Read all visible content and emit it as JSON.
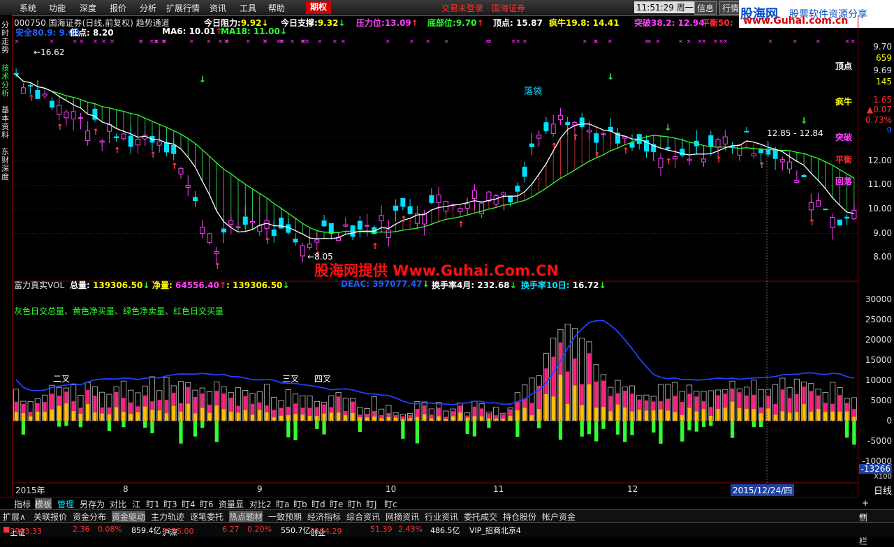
{
  "menu": {
    "items": [
      "系统",
      "功能",
      "深度",
      "报价",
      "分析",
      "扩展行情",
      "资讯",
      "工具",
      "帮助"
    ],
    "options_label": "期权",
    "status": "交易未登录",
    "broker": "国海证券",
    "time": "11:51:29",
    "weekday": "周一",
    "btn_info": "信息",
    "btn_quote": "行情"
  },
  "brand": {
    "name": "股海网",
    "slogan": "股票软件资源分享",
    "url": "www.Guhai.com.cn"
  },
  "left_tabs": [
    "分时走势",
    "技术分析",
    "基本资料",
    "东财深度"
  ],
  "header": {
    "stock": "000750 国海证券(日线,前复权) 趋势通道",
    "resist_label": "今日阻力:",
    "resist": "9.92",
    "support_label": "今日支撑:",
    "support": "9.32",
    "press_label": "压力位:",
    "press": "13.09",
    "bottom_label": "底部位:",
    "bottom": "9.70",
    "top_label": "顶点:",
    "top": "15.87",
    "bull_label": "疯牛",
    "bull1": "19.8:",
    "bull2": "14.41",
    "break_label": "突破",
    "break1": "38.2:",
    "break2": "12.94",
    "balance_label": "平衡50:",
    "safe_label": "安全",
    "safe1": "80.9:",
    "safe2": "9.68",
    "low_label": "低点:",
    "low": "8.20",
    "ma6_label": "MA6:",
    "ma6": "10.01",
    "ma18_label": "MA18:",
    "ma18": "11.00"
  },
  "price_labels": {
    "hi": "16.62",
    "lo": "8.05",
    "channel": "12.85 - 12.84",
    "fall": "落袋",
    "watermark": "股海网提供 Www.Guhai.Com.CN",
    "tags": [
      "顶点",
      "疯牛",
      "突破",
      "平衡",
      "回落"
    ]
  },
  "price_axis": [
    "9.70",
    "659",
    "9.69",
    "145",
    "1.65",
    "▲0.07",
    "0.73%",
    "9",
    "12.00",
    "11.00",
    "10.00",
    "9.00",
    "8.00"
  ],
  "vol_header": {
    "name": "富力真实VOL",
    "total_label": "总量:",
    "total": "139306.50",
    "net_label": "净量:",
    "net": "64556.40",
    "extra": ":  139306.50",
    "deac_label": "DEAC:",
    "deac": "397077.47",
    "turn4_label": "换手率4月:",
    "turn4": "232.68",
    "turn10_label": "换手率10日:",
    "turn10": "16.72"
  },
  "vol_legend": "灰色日交总量、黄色净买量、绿色净卖量、红色日交买量",
  "vol_marks": [
    "二叉",
    "三叉",
    "四叉"
  ],
  "vol_axis": [
    "30000",
    "25000",
    "20000",
    "15000",
    "10000",
    "5000",
    "0",
    "-5000",
    "-10000"
  ],
  "vol_cur": "-13266",
  "vol_unit": "X100",
  "date_axis": [
    "2015年",
    "8",
    "9",
    "10",
    "11",
    "12"
  ],
  "cursor_date": "2015/12/24/四",
  "period": "日线",
  "tabs": [
    "指标",
    "模板",
    "管理",
    "另存为",
    "对比",
    "江",
    "盯1",
    "盯3",
    "盯4",
    "盯6",
    "资量显",
    "对比2",
    "盯a",
    "盯b",
    "盯d",
    "盯e",
    "盯h",
    "盯J",
    "盯c"
  ],
  "funcs": [
    "扩展∧",
    "关联报价",
    "资金分布",
    "资金驱动",
    "主力轨迹",
    "逐笔委托",
    "热点题材",
    "一致预期",
    "经济指标",
    "综合资讯",
    "网摘资讯",
    "行业资讯",
    "委托成交",
    "持仓股份",
    "帐户资金"
  ],
  "side_toggle": "侧边栏",
  "status": {
    "sh_label": "上证",
    "sh": "2903.33",
    "sh_chg": "2.36",
    "sh_pct": "0.08%",
    "sh_amt": "859.4亿",
    "hs_label": "沪深",
    "hs": "3125.00",
    "hs_chg": "6.27",
    "hs_pct": "0.20%",
    "hs_amt": "550.7亿",
    "cy_label": "创业",
    "cy": "2164.29",
    "cy_chg": "51.39",
    "cy_pct": "2.43%",
    "cy_amt": "486.5亿",
    "vip": "VIP_招商北京4"
  },
  "colors": {
    "up": "#ff3030",
    "down": "#00e0ff",
    "green": "#30ff30",
    "yellow": "#ffff00",
    "magenta": "#ff40ff"
  }
}
